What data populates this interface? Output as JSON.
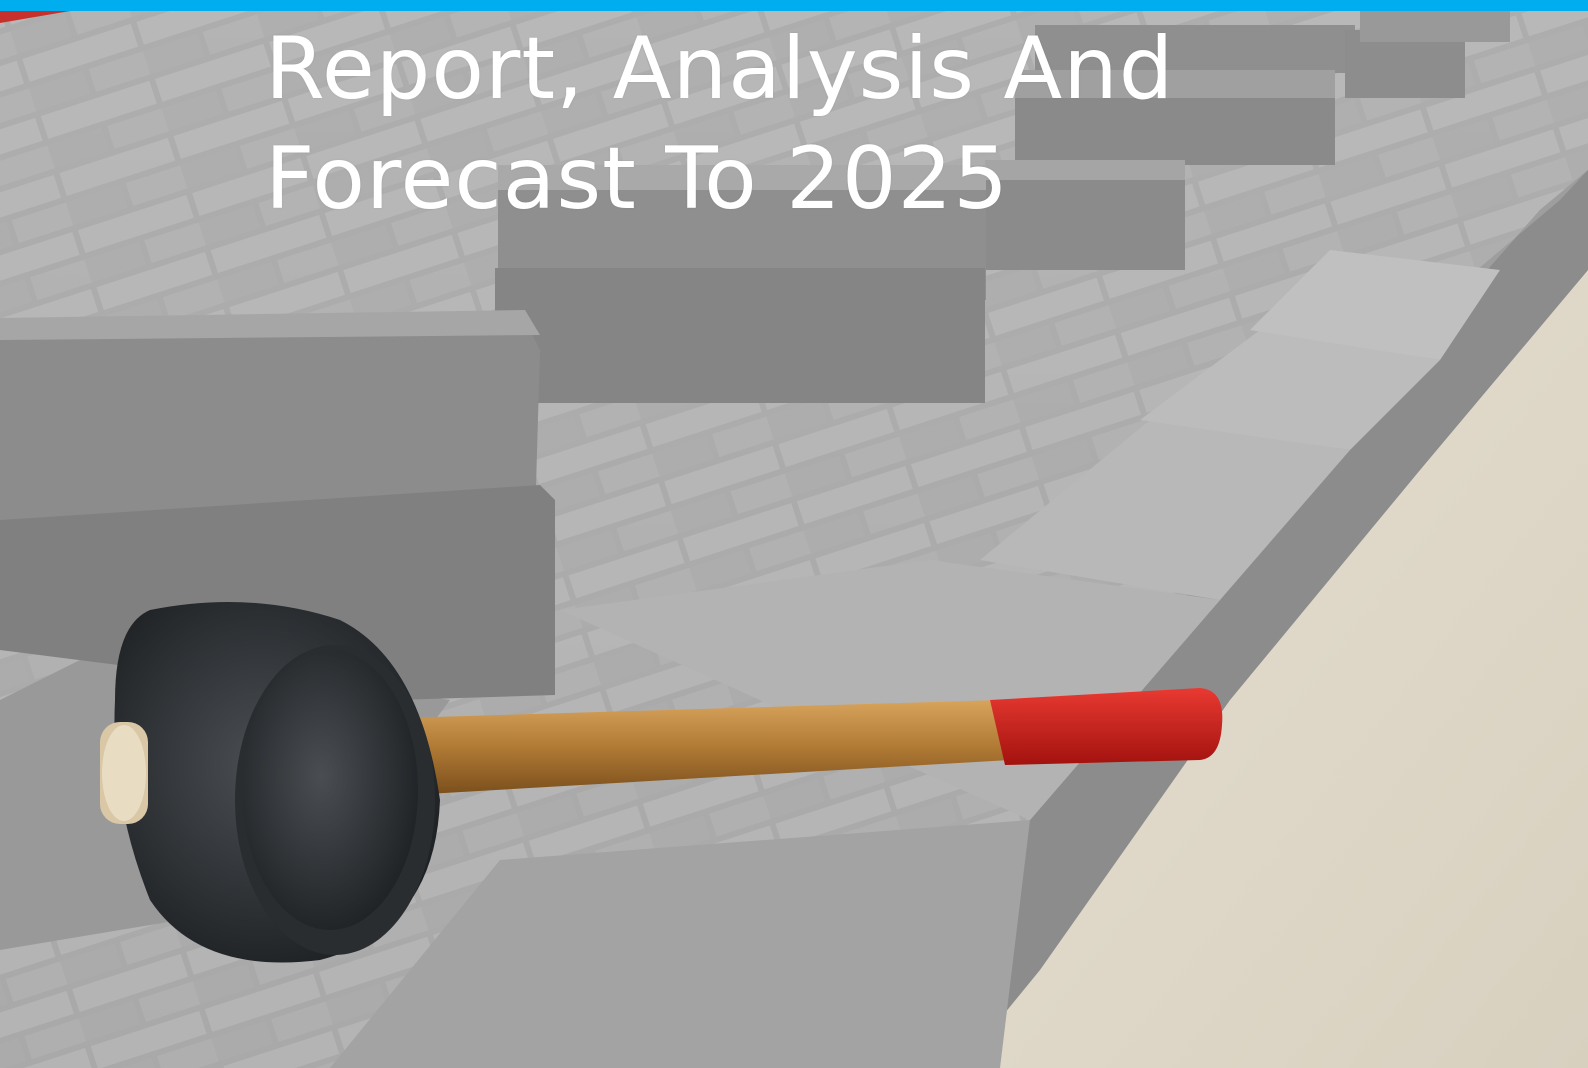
{
  "slide": {
    "title_line_1": "Report, Analysis And",
    "title_line_2": "Forecast To 2025",
    "accent_color": "#00aeef",
    "corner_color": "#c8302b",
    "background_photo": "paving-blocks-with-rubber-mallet"
  }
}
